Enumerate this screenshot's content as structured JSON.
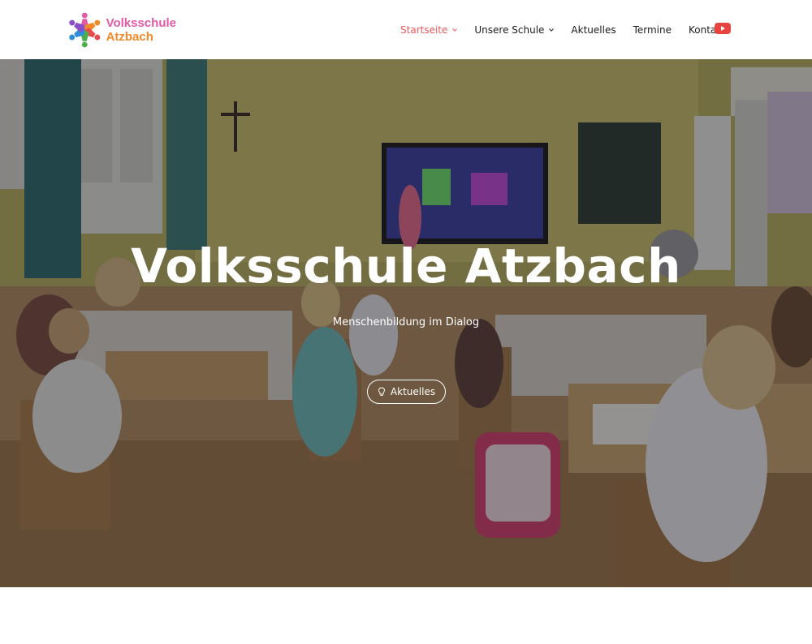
{
  "brand": {
    "line1": "Volksschule",
    "line2": "Atzbach",
    "colors": {
      "pink": "#e05aa7",
      "orange": "#f08a2a",
      "blue": "#2f8fd6",
      "green": "#4bb04a",
      "purple": "#8a4fc7",
      "red": "#e84b4b"
    }
  },
  "nav": {
    "items": [
      {
        "label": "Startseite",
        "active": true,
        "dropdown": true
      },
      {
        "label": "Unsere Schule",
        "active": false,
        "dropdown": true
      },
      {
        "label": "Aktuelles",
        "active": false,
        "dropdown": false
      },
      {
        "label": "Termine",
        "active": false,
        "dropdown": false
      },
      {
        "label": "Kontakt",
        "active": false,
        "dropdown": false
      }
    ],
    "active_color": "#e85a5a",
    "social_icon": "youtube-icon",
    "social_color": "#e8443f"
  },
  "hero": {
    "title": "Volksschule Atzbach",
    "subtitle": "Menschenbildung im Dialog",
    "button_label": "Aktuelles",
    "button_icon": "lightbulb-icon",
    "image": "classroom-photo"
  }
}
